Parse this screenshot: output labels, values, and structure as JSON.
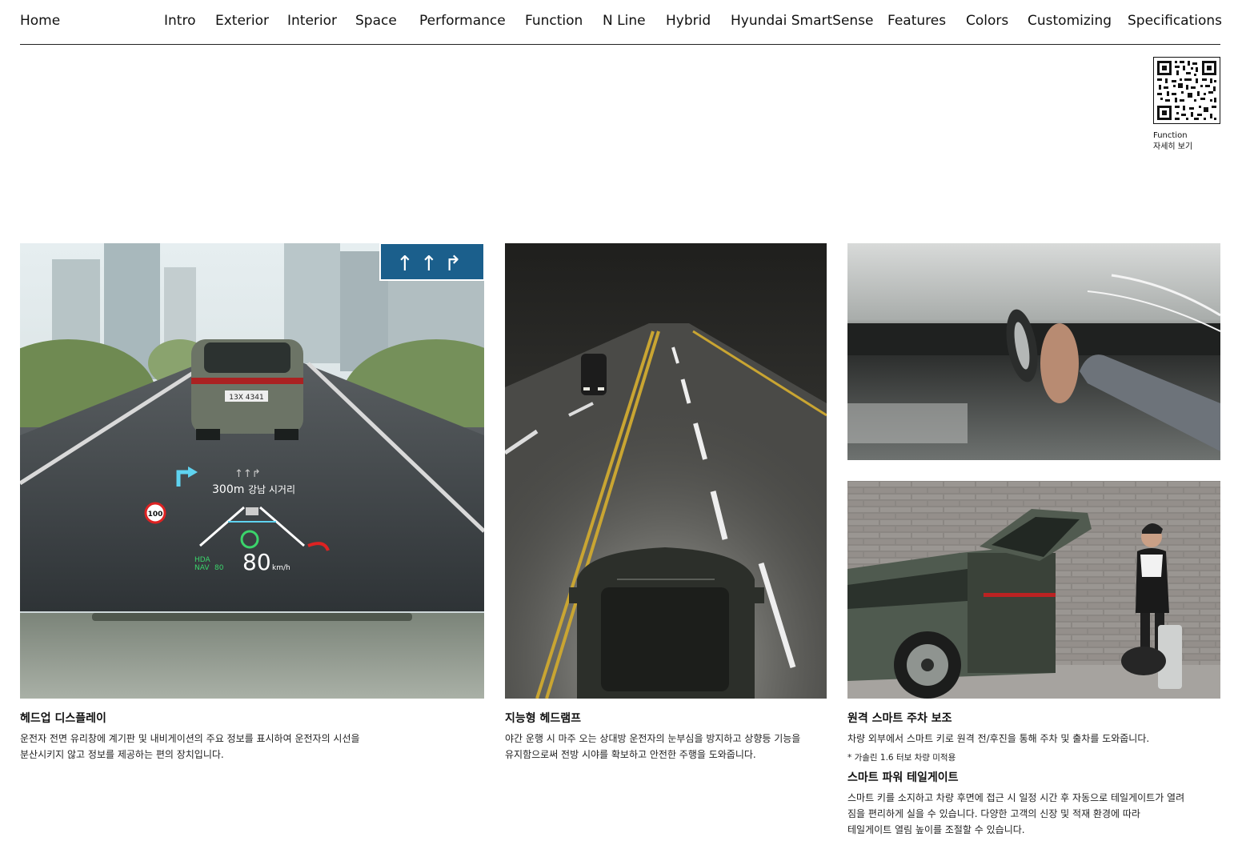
{
  "nav": {
    "home": "Home",
    "items": [
      "Intro",
      "Exterior",
      "Interior",
      "Space",
      "Performance",
      "Function",
      "N Line",
      "Hybrid",
      "Hyundai SmartSense",
      "Features",
      "Colors",
      "Customizing",
      "Specifications"
    ]
  },
  "qr": {
    "caption_line1": "Function",
    "caption_line2": "자세히 보기"
  },
  "hud": {
    "distance": "300m",
    "street": "강남 시거리",
    "speed": "80",
    "speed_unit": "km/h",
    "speed_limit": "100",
    "hda": "HDA",
    "nav": "NAV",
    "set_speed": "80",
    "plate": "13X 4341"
  },
  "features": [
    {
      "title": "헤드업 디스플레이",
      "desc_line1": "운전자 전면 유리창에 계기판 및 내비게이션의 주요 정보를 표시하여 운전자의 시선을",
      "desc_line2": "분산시키지 않고 정보를 제공하는 편의 장치입니다."
    },
    {
      "title": "지능형 헤드램프",
      "desc_line1": "야간 운행 시 마주 오는 상대방 운전자의 눈부심을 방지하고 상향등 기능을",
      "desc_line2": "유지함으로써 전방 시야를 확보하고 안전한 주행을 도와줍니다."
    },
    {
      "title": "원격 스마트 주차 보조",
      "desc_line1": "차량 외부에서 스마트 키로 원격 전/후진을 통해 주차 및 출차를 도와줍니다.",
      "note": "* 가솔린 1.6 터보 차량 미적용"
    },
    {
      "title": "스마트 파워 테일게이트",
      "desc_line1": "스마트 키를 소지하고 차량 후면에 접근 시 일정 시간 후 자동으로 테일게이트가 열려",
      "desc_line2": "짐을 편리하게 실을 수 있습니다. 다양한 고객의 신장 및 적재 환경에 따라",
      "desc_line3": "테일게이트 열림 높이를 조절할 수 있습니다."
    }
  ],
  "colors": {
    "text": "#111111",
    "rule": "#222222",
    "hud_cyan": "#5fd3f0",
    "hud_green": "#3bd46b"
  }
}
